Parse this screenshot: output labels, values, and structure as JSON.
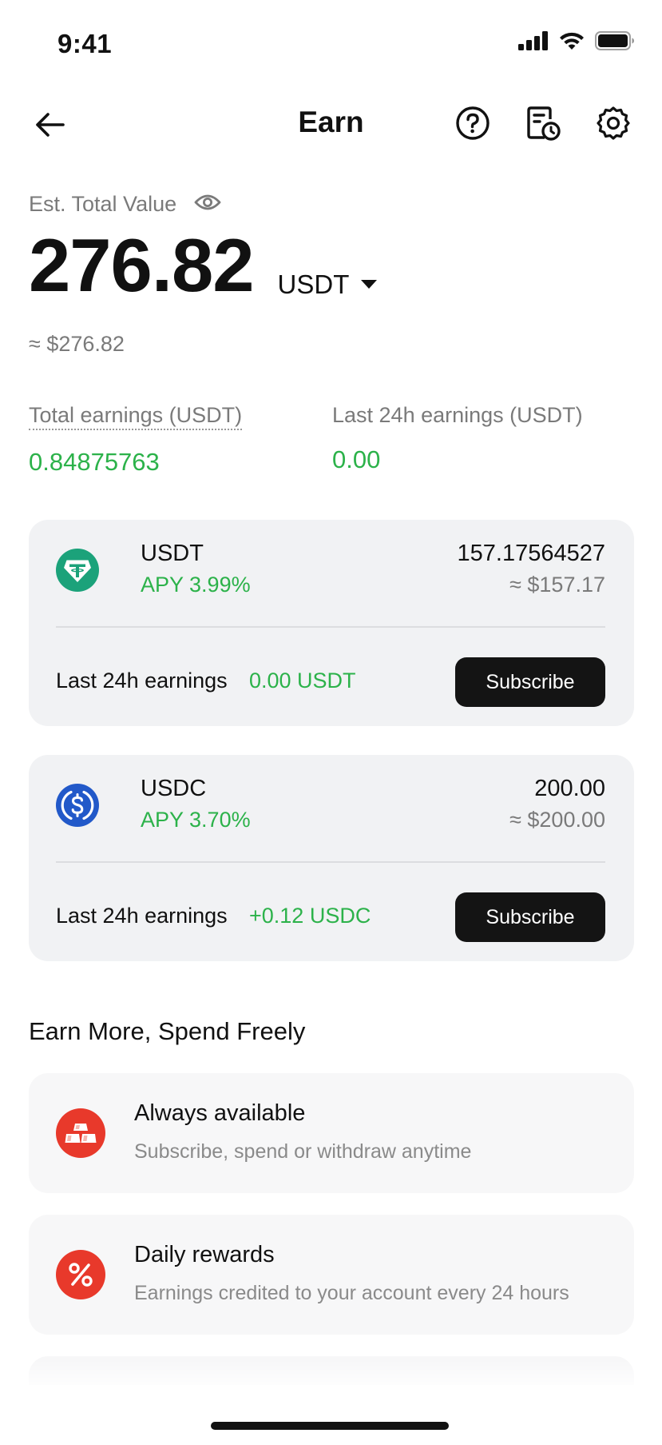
{
  "status_bar": {
    "time": "9:41",
    "icons": [
      "signal-icon",
      "wifi-icon",
      "battery-icon"
    ]
  },
  "nav": {
    "title": "Earn",
    "icons": [
      "back-arrow-icon",
      "help-icon",
      "history-icon",
      "settings-icon"
    ]
  },
  "summary": {
    "est_label": "Est. Total Value",
    "total_value": "276.82",
    "currency": "USDT",
    "usd_approx": "≈ $276.82",
    "total_earnings_label": "Total earnings (USDT)",
    "total_earnings_value": "0.84875763",
    "last24_label": "Last 24h earnings (USDT)",
    "last24_value": "0.00"
  },
  "assets": [
    {
      "name": "USDT",
      "apy": "APY 3.99%",
      "amount": "157.17564527",
      "usd": "≈ $157.17",
      "last24_label": "Last 24h earnings",
      "last24_value": "0.00 USDT",
      "button": "Subscribe",
      "icon": "tether-icon",
      "color": "#1ba27a"
    },
    {
      "name": "USDC",
      "apy": "APY 3.70%",
      "amount": "200.00",
      "usd": "≈ $200.00",
      "last24_label": "Last 24h earnings",
      "last24_value": "+0.12 USDC",
      "button": "Subscribe",
      "icon": "usdc-icon",
      "color": "#2259c9"
    }
  ],
  "section": {
    "title": "Earn More, Spend Freely"
  },
  "features": [
    {
      "title": "Always available",
      "desc": "Subscribe, spend or withdraw anytime",
      "icon": "gold-bars-icon"
    },
    {
      "title": "Daily rewards",
      "desc": "Earnings credited to your account every 24 hours",
      "icon": "percent-icon"
    }
  ],
  "colors": {
    "positive": "#2cb24a",
    "accent_red": "#e8392b",
    "button_dark": "#141414"
  }
}
